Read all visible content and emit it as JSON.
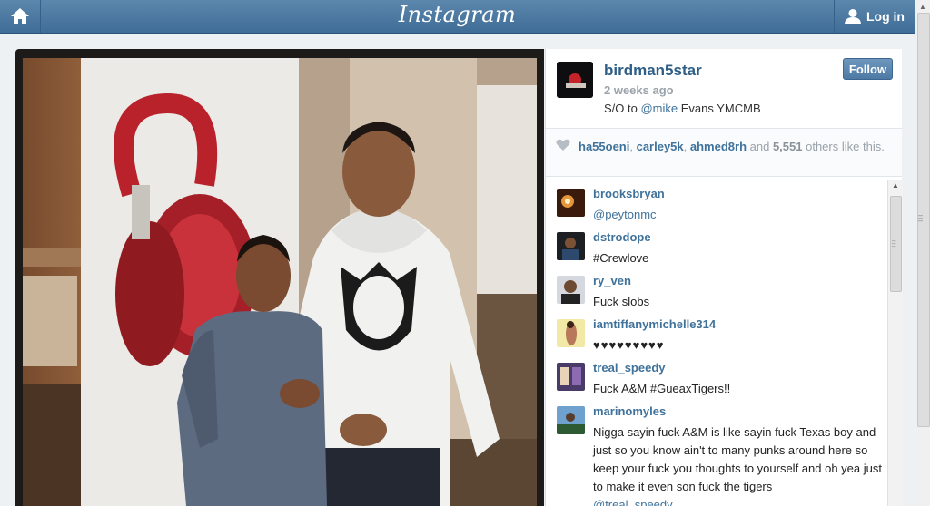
{
  "topbar": {
    "logo": "Instagram",
    "login_label": "Log in",
    "icons": {
      "home": "home-icon",
      "user": "user-icon"
    }
  },
  "post": {
    "username": "birdman5star",
    "time": "2 weeks ago",
    "caption_prefix": "S/O to ",
    "caption_mention": "@mike",
    "caption_suffix": " Evans YMCMB",
    "follow_label": "Follow",
    "likes": {
      "users": [
        "ha55oeni",
        "carley5k",
        "ahmed8rh"
      ],
      "sep": ", ",
      "and_text": " and ",
      "count": "5,551",
      "others_text": " others like this."
    }
  },
  "comments": [
    {
      "user": "brooksbryan",
      "text": "",
      "mention": "@peytonmc"
    },
    {
      "user": "dstrodope",
      "text": "#Crewlove",
      "mention": ""
    },
    {
      "user": "ry_ven",
      "text": "Fuck slobs",
      "mention": ""
    },
    {
      "user": "iamtiffanymichelle314",
      "text": "♥♥♥♥♥♥♥♥♥",
      "mention": ""
    },
    {
      "user": "treal_speedy",
      "text": "Fuck A&M #GueaxTigers!!",
      "mention": ""
    },
    {
      "user": "marinomyles",
      "text": "Nigga sayin fuck A&M is like sayin fuck Texas boy and just so you know ain't to many punks around here so keep your fuck you thoughts to yourself and oh yea just to make it even son fuck the tigers",
      "mention": "@treal_speedy"
    }
  ],
  "colors": {
    "topbar": "#4a77a0",
    "link": "#3f729b",
    "username": "#2e5e86",
    "follow": "#5a86b0"
  }
}
